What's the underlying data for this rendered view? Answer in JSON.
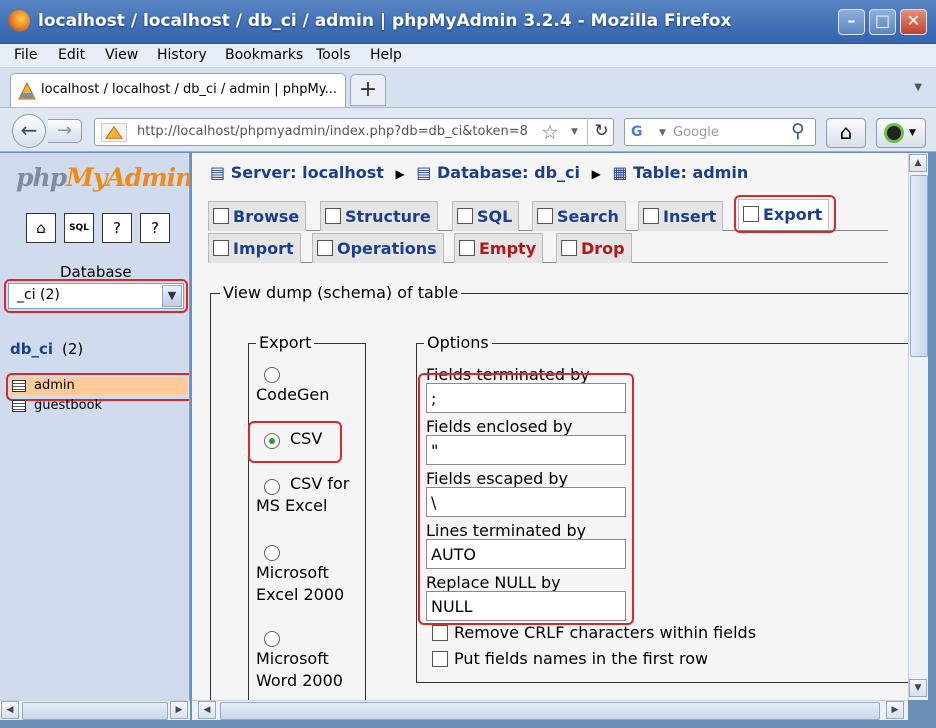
{
  "window": {
    "title": "localhost / localhost / db_ci / admin | phpMyAdmin 3.2.4 - Mozilla Firefox",
    "minimize": "–",
    "maximize": "□",
    "close": "✕"
  },
  "menu": [
    "File",
    "Edit",
    "View",
    "History",
    "Bookmarks",
    "Tools",
    "Help"
  ],
  "tab": {
    "label": "localhost / localhost / db_ci / admin | phpMy...",
    "new_tab": "+"
  },
  "nav": {
    "url": "http://localhost/phpmyadmin/index.php?db=db_ci&token=8",
    "search_placeholder": "Google",
    "search_engine": "G"
  },
  "sidebar": {
    "logo_php": "php",
    "logo_my": "MyAdmin",
    "database_label": "Database",
    "database_selected": "_ci (2)",
    "db_link": "db_ci",
    "db_count": "(2)",
    "tables": [
      {
        "name": "admin",
        "selected": true
      },
      {
        "name": "guestbook",
        "selected": false
      }
    ]
  },
  "breadcrumb": {
    "server": "Server: localhost",
    "database": "Database: db_ci",
    "table": "Table: admin"
  },
  "tabs_row1": [
    "Browse",
    "Structure",
    "SQL",
    "Search",
    "Insert",
    "Export"
  ],
  "tabs_row2": [
    "Import",
    "Operations",
    "Empty",
    "Drop"
  ],
  "dump": {
    "legend": "View dump (schema) of table",
    "export_legend": "Export",
    "formats": [
      {
        "label": "CodeGen",
        "checked": false
      },
      {
        "label": "CSV",
        "checked": true
      },
      {
        "label": "CSV for MS Excel",
        "checked": false
      },
      {
        "label": "Microsoft Excel 2000",
        "checked": false
      },
      {
        "label": "Microsoft Word 2000",
        "checked": false
      }
    ],
    "options_legend": "Options",
    "fields": [
      {
        "label": "Fields terminated by",
        "value": ";"
      },
      {
        "label": "Fields enclosed by",
        "value": "\""
      },
      {
        "label": "Fields escaped by",
        "value": "\\"
      },
      {
        "label": "Lines terminated by",
        "value": "AUTO"
      },
      {
        "label": "Replace NULL by",
        "value": "NULL"
      }
    ],
    "checkboxes": [
      {
        "label": "Remove CRLF characters within fields",
        "checked": false
      },
      {
        "label": "Put fields names in the first row",
        "checked": false
      }
    ]
  },
  "colors": {
    "highlight": "#d62a2a",
    "link": "#1a3f8e",
    "selected_row": "#ffcc99"
  }
}
